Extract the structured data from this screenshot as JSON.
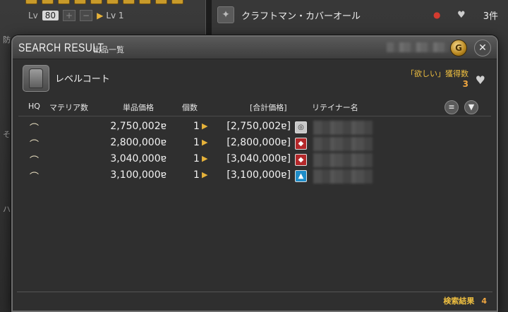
{
  "background_left": {
    "lv_label": "Lv",
    "lv_value": "80",
    "plus": "+",
    "minus": "−",
    "lv_text": "Lv 1",
    "side_labels": [
      "防",
      "そ",
      "ハ"
    ]
  },
  "background_right": {
    "item_name": "クラフトマン・カバーオール",
    "count": "3件"
  },
  "window": {
    "title": "SEARCH RESULT",
    "subtitle": "出品一覧",
    "item_name": "レベルコート",
    "wish_label": "「欲しい」獲得数",
    "wish_count": "3",
    "columns": {
      "hq": "HQ",
      "materia": "マテリア数",
      "unit_price": "単品価格",
      "qty": "個数",
      "total": "[合計価格]",
      "retainer": "リテイナー名"
    },
    "listings": [
      {
        "price": "2,750,002ɐ",
        "qty": "1",
        "total": "[2,750,002ɐ]",
        "town": "sw"
      },
      {
        "price": "2,800,000ɐ",
        "qty": "1",
        "total": "[2,800,000ɐ]",
        "town": "red"
      },
      {
        "price": "3,040,000ɐ",
        "qty": "1",
        "total": "[3,040,000ɐ]",
        "town": "red"
      },
      {
        "price": "3,100,000ɐ",
        "qty": "1",
        "total": "[3,100,000ɐ]",
        "town": "blue"
      }
    ],
    "footer_label": "検索結果",
    "footer_count": "4"
  },
  "icons": {
    "hq": "hq-icon",
    "gil": "gil-icon",
    "close": "close-icon",
    "heart": "heart-icon",
    "sort": "sort-icon",
    "filter": "filter-icon"
  }
}
